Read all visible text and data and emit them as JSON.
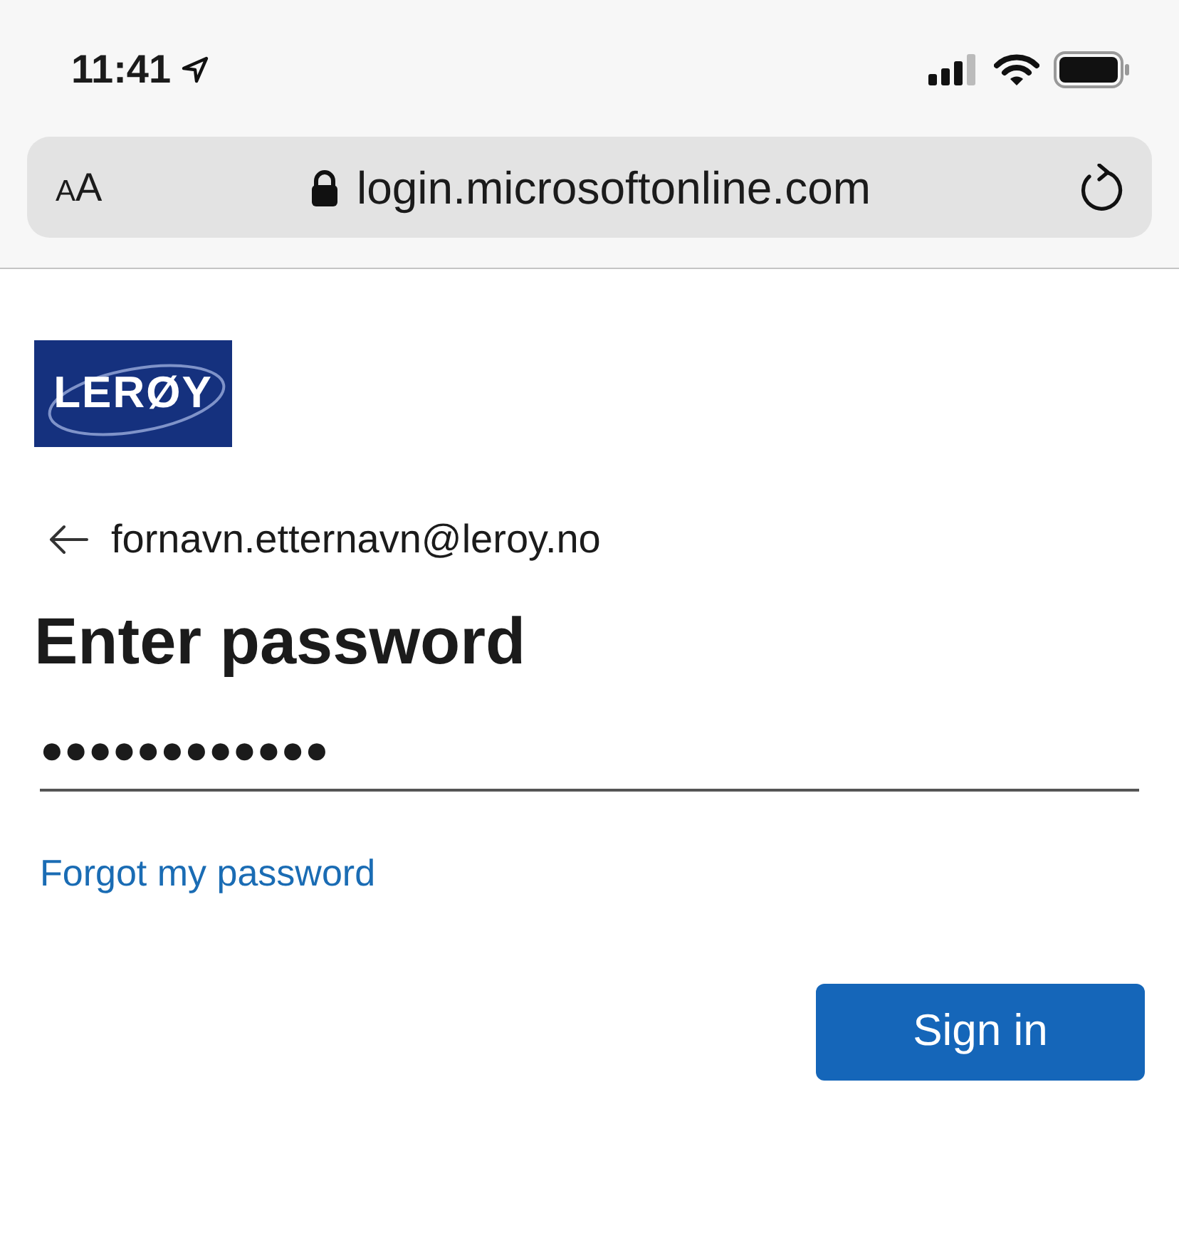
{
  "status_bar": {
    "time": "11:41"
  },
  "address_bar": {
    "text_size_label": "AA",
    "url": "login.microsoftonline.com"
  },
  "logo": {
    "text": "LERØY"
  },
  "account": {
    "email": "fornavn.etternavn@leroy.no"
  },
  "heading": "Enter password",
  "password_field": {
    "value": "●●●●●●●●●●●●"
  },
  "forgot_link": "Forgot my password",
  "buttons": [
    {
      "label": "Sign in",
      "kind": "primary"
    }
  ]
}
